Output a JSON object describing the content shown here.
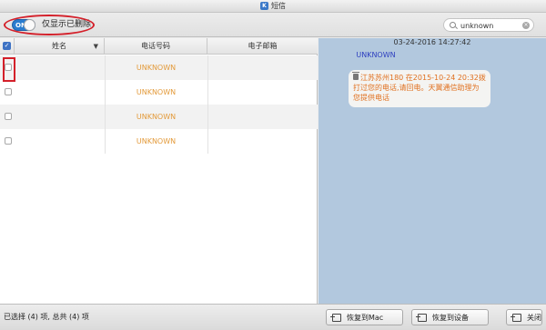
{
  "window": {
    "title": "短信",
    "app_icon_letter": "K"
  },
  "toolbar": {
    "toggle_state": "ON",
    "toggle_label": "仅显示已删除",
    "search_value": "unknown",
    "search_clear": "×"
  },
  "table": {
    "headers": {
      "name": "姓名",
      "sort_indicator": "▼",
      "phone": "电话号码",
      "email": "电子邮箱"
    },
    "header_check": "✓",
    "rows": [
      {
        "name": "",
        "phone": "UNKNOWN",
        "email": ""
      },
      {
        "name": "",
        "phone": "UNKNOWN",
        "email": ""
      },
      {
        "name": "",
        "phone": "UNKNOWN",
        "email": ""
      },
      {
        "name": "",
        "phone": "UNKNOWN",
        "email": ""
      }
    ]
  },
  "message": {
    "timestamp": "03-24-2016 14:27:42",
    "contact": "UNKNOWN",
    "body": "江苏苏州180 在2015-10-24 20:32拨打过您的电话,请回电。天翼通信助理为您提供电话"
  },
  "status": {
    "summary": "已选择 (4) 项, 总共 (4) 项",
    "restore_mac": "恢复到Mac",
    "restore_device": "恢复到设备",
    "close": "关闭"
  },
  "colors": {
    "accent": "#2a7ccf",
    "annotation_red": "#d4202a",
    "unknown_orange": "#e39a3a",
    "message_orange": "#e0701f",
    "right_pane_bg": "#b2c8de"
  },
  "icons": [
    "search-icon",
    "clear-icon",
    "trash-icon",
    "restore-icon",
    "exit-icon",
    "sort-arrow-icon"
  ]
}
